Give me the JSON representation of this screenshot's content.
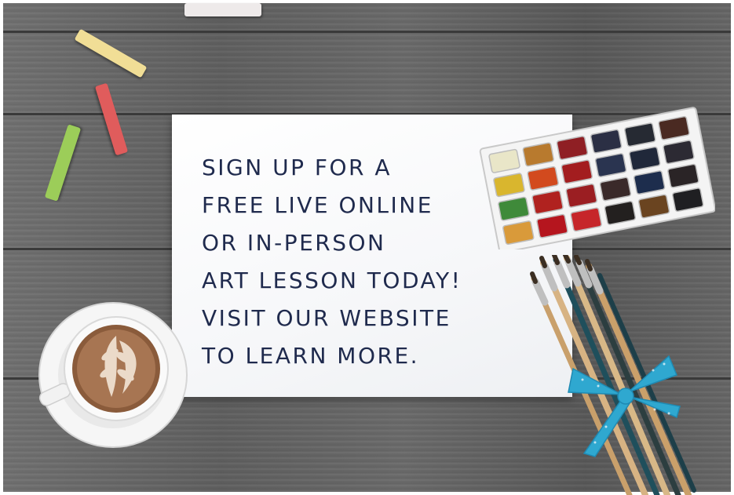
{
  "scene": {
    "description_elements": [
      "wood-table",
      "paper-card",
      "chalk-sticks",
      "watercolor-palette",
      "paint-brushes",
      "coffee-cup",
      "ribbon-bow"
    ]
  },
  "card": {
    "lines": [
      "SIGN UP FOR A",
      "FREE LIVE ONLINE",
      "OR IN-PERSON",
      "ART LESSON TODAY!",
      "VISIT OUR WEBSITE",
      "TO LEARN MORE."
    ],
    "text_color": "#1f2a4d"
  },
  "palette": {
    "colors": [
      "#e9e6c8",
      "#b87a2e",
      "#8f1f24",
      "#2b2f44",
      "#262a33",
      "#4a2a22",
      "#d9b62e",
      "#d24a1e",
      "#a31d1f",
      "#2a3450",
      "#20283a",
      "#2c2a33",
      "#3f8a3a",
      "#b0221f",
      "#9b1e22",
      "#3a2a2a",
      "#1d2d4d",
      "#2a2426",
      "#d99a3a",
      "#b5151e",
      "#c6262a",
      "#23201f",
      "#6a4420",
      "#1f1f22"
    ]
  },
  "chalk": {
    "colors": [
      "#f2eeee",
      "#f4e39c",
      "#e56060",
      "#9fd15c"
    ]
  },
  "ribbon": {
    "color": "#2fa8d0"
  }
}
